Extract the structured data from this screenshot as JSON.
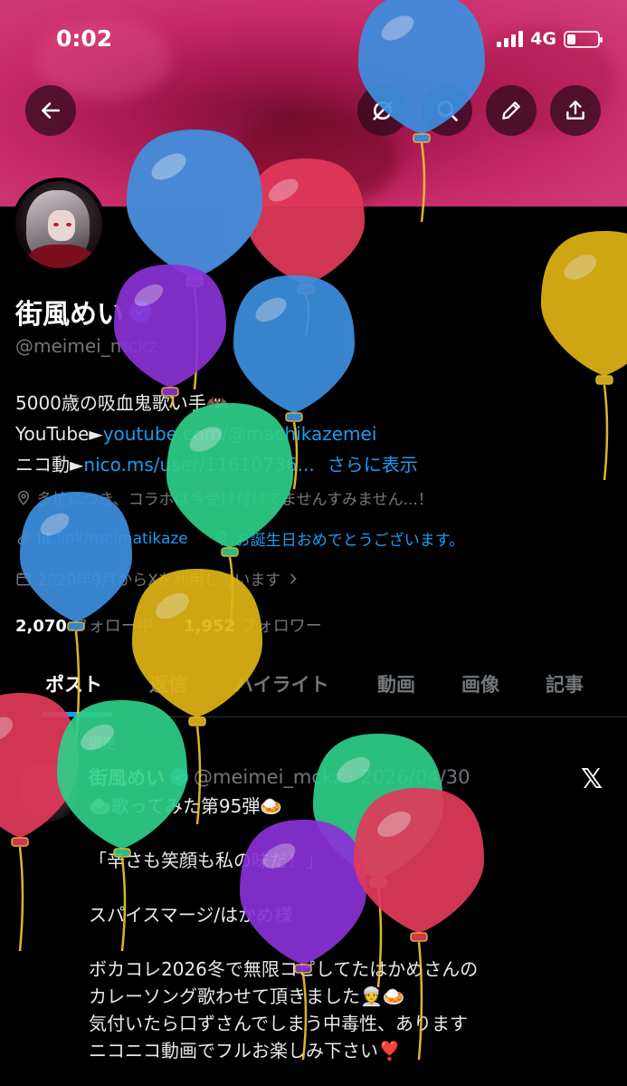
{
  "status": {
    "time": "0:02",
    "network": "4G"
  },
  "header": {
    "back_icon": "arrow-left-icon",
    "actions": [
      "sync-off-icon",
      "search-icon",
      "edit-pencil-icon",
      "share-upload-icon"
    ]
  },
  "profile": {
    "display_name": "街風めい",
    "handle": "@meimei_mckz",
    "bio_line1": "5000歳の吸血鬼歌い手🦇",
    "bio_yt_prefix": "YouTube►",
    "bio_yt_link": "youtube.com/@machikazemei",
    "bio_nico_prefix": "ニコ動►",
    "bio_nico_link": "nico.ms/user/11610736...",
    "bio_more": "さらに表示",
    "location": "多忙につき、コラボは今受け付けてませんすみません...！",
    "website": "lit.link/meimatikaze",
    "birthday": "お誕生日おめでとうございます。",
    "joined": "2020年9月からXを利用しています",
    "following_count": "2,070",
    "following_label": "フォロー中",
    "followers_count": "1,952",
    "followers_label": "フォロワー"
  },
  "tabs": [
    "ポスト",
    "返信",
    "ハイライト",
    "動画",
    "画像",
    "記事"
  ],
  "post": {
    "pinned_label": "固定",
    "author_name": "街風めい",
    "author_handle": "@meimei_mckz",
    "date": "· 2026/04/30",
    "body": "🍛歌ってみた第95弾🍛\n\n「辛さも笑顔も私の味だ！」\n\nスパイスマージ/はかめ様\n\nボカコレ2026冬で無限コピしてたはかめさんの\nカレーソング歌わせて頂きました👳🍛\n気付いたら口ずさんでしまう中毒性、あります\nニコニコ動画でフルお楽しみ下さい❣️"
  },
  "colors": {
    "accent": "#1d9bf0",
    "balloon_blue": "#3d8fe0",
    "balloon_red": "#e23a5a",
    "balloon_purple": "#8a32d6",
    "balloon_green": "#2ecf8a",
    "balloon_yellow": "#e0b414"
  }
}
